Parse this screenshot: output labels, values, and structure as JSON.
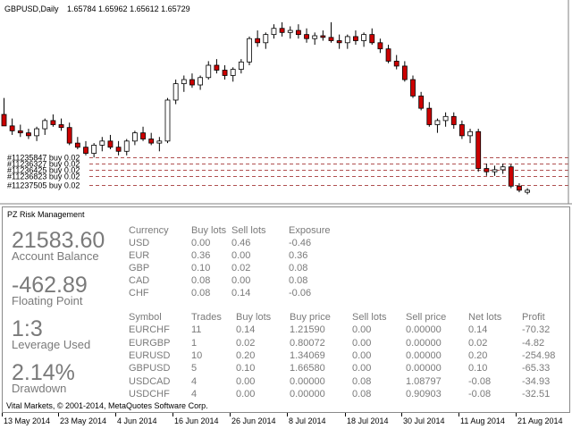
{
  "chart_data": {
    "type": "candlestick",
    "symbol_header": "GBPUSD,Daily",
    "ohlc_header": "1.65784 1.65962 1.65612 1.65729",
    "candles": [
      {
        "o": 1.7,
        "h": 1.704,
        "l": 1.699,
        "c": 1.6972,
        "dir": "down"
      },
      {
        "o": 1.6972,
        "h": 1.699,
        "l": 1.695,
        "c": 1.696,
        "dir": "down"
      },
      {
        "o": 1.696,
        "h": 1.6975,
        "l": 1.6945,
        "c": 1.6955,
        "dir": "down"
      },
      {
        "o": 1.6955,
        "h": 1.6965,
        "l": 1.694,
        "c": 1.6948,
        "dir": "down"
      },
      {
        "o": 1.6948,
        "h": 1.697,
        "l": 1.6935,
        "c": 1.6965,
        "dir": "up"
      },
      {
        "o": 1.6965,
        "h": 1.699,
        "l": 1.695,
        "c": 1.6985,
        "dir": "up"
      },
      {
        "o": 1.6985,
        "h": 1.7,
        "l": 1.697,
        "c": 1.6975,
        "dir": "down"
      },
      {
        "o": 1.6975,
        "h": 1.699,
        "l": 1.696,
        "c": 1.6968,
        "dir": "down"
      },
      {
        "o": 1.6968,
        "h": 1.698,
        "l": 1.6925,
        "c": 1.693,
        "dir": "down"
      },
      {
        "o": 1.693,
        "h": 1.6945,
        "l": 1.6915,
        "c": 1.692,
        "dir": "down"
      },
      {
        "o": 1.692,
        "h": 1.6935,
        "l": 1.69,
        "c": 1.6905,
        "dir": "down"
      },
      {
        "o": 1.6905,
        "h": 1.693,
        "l": 1.6895,
        "c": 1.6925,
        "dir": "up"
      },
      {
        "o": 1.6925,
        "h": 1.6945,
        "l": 1.691,
        "c": 1.6935,
        "dir": "up"
      },
      {
        "o": 1.6935,
        "h": 1.695,
        "l": 1.6915,
        "c": 1.692,
        "dir": "down"
      },
      {
        "o": 1.692,
        "h": 1.6935,
        "l": 1.69,
        "c": 1.691,
        "dir": "down"
      },
      {
        "o": 1.691,
        "h": 1.694,
        "l": 1.69,
        "c": 1.6935,
        "dir": "up"
      },
      {
        "o": 1.6935,
        "h": 1.696,
        "l": 1.6925,
        "c": 1.6955,
        "dir": "up"
      },
      {
        "o": 1.6955,
        "h": 1.697,
        "l": 1.6935,
        "c": 1.694,
        "dir": "down"
      },
      {
        "o": 1.694,
        "h": 1.6955,
        "l": 1.6925,
        "c": 1.693,
        "dir": "down"
      },
      {
        "o": 1.693,
        "h": 1.6945,
        "l": 1.691,
        "c": 1.6935,
        "dir": "up"
      },
      {
        "o": 1.6935,
        "h": 1.704,
        "l": 1.693,
        "c": 1.7035,
        "dir": "up"
      },
      {
        "o": 1.7035,
        "h": 1.7085,
        "l": 1.7025,
        "c": 1.7075,
        "dir": "up"
      },
      {
        "o": 1.7075,
        "h": 1.7095,
        "l": 1.7055,
        "c": 1.7085,
        "dir": "up"
      },
      {
        "o": 1.7085,
        "h": 1.71,
        "l": 1.7065,
        "c": 1.7072,
        "dir": "down"
      },
      {
        "o": 1.7072,
        "h": 1.7095,
        "l": 1.706,
        "c": 1.709,
        "dir": "up"
      },
      {
        "o": 1.709,
        "h": 1.713,
        "l": 1.7085,
        "c": 1.712,
        "dir": "up"
      },
      {
        "o": 1.712,
        "h": 1.7135,
        "l": 1.71,
        "c": 1.7108,
        "dir": "down"
      },
      {
        "o": 1.7108,
        "h": 1.712,
        "l": 1.7085,
        "c": 1.7095,
        "dir": "down"
      },
      {
        "o": 1.7095,
        "h": 1.7115,
        "l": 1.708,
        "c": 1.711,
        "dir": "up"
      },
      {
        "o": 1.711,
        "h": 1.7135,
        "l": 1.71,
        "c": 1.7128,
        "dir": "up"
      },
      {
        "o": 1.7128,
        "h": 1.719,
        "l": 1.712,
        "c": 1.7185,
        "dir": "up"
      },
      {
        "o": 1.7185,
        "h": 1.7205,
        "l": 1.7165,
        "c": 1.7175,
        "dir": "down"
      },
      {
        "o": 1.7175,
        "h": 1.72,
        "l": 1.716,
        "c": 1.7195,
        "dir": "up"
      },
      {
        "o": 1.7195,
        "h": 1.722,
        "l": 1.7185,
        "c": 1.721,
        "dir": "up"
      },
      {
        "o": 1.721,
        "h": 1.7225,
        "l": 1.719,
        "c": 1.72,
        "dir": "down"
      },
      {
        "o": 1.72,
        "h": 1.7215,
        "l": 1.7185,
        "c": 1.7205,
        "dir": "up"
      },
      {
        "o": 1.7205,
        "h": 1.722,
        "l": 1.7185,
        "c": 1.7195,
        "dir": "down"
      },
      {
        "o": 1.7195,
        "h": 1.721,
        "l": 1.7175,
        "c": 1.7185,
        "dir": "down"
      },
      {
        "o": 1.7185,
        "h": 1.72,
        "l": 1.717,
        "c": 1.7192,
        "dir": "up"
      },
      {
        "o": 1.7192,
        "h": 1.7205,
        "l": 1.718,
        "c": 1.7188,
        "dir": "down"
      },
      {
        "o": 1.7188,
        "h": 1.7225,
        "l": 1.7175,
        "c": 1.718,
        "dir": "down"
      },
      {
        "o": 1.718,
        "h": 1.7195,
        "l": 1.716,
        "c": 1.7175,
        "dir": "down"
      },
      {
        "o": 1.7175,
        "h": 1.7195,
        "l": 1.716,
        "c": 1.719,
        "dir": "up"
      },
      {
        "o": 1.719,
        "h": 1.7205,
        "l": 1.717,
        "c": 1.718,
        "dir": "down"
      },
      {
        "o": 1.718,
        "h": 1.72,
        "l": 1.7165,
        "c": 1.7195,
        "dir": "up"
      },
      {
        "o": 1.7195,
        "h": 1.721,
        "l": 1.717,
        "c": 1.7175,
        "dir": "down"
      },
      {
        "o": 1.7175,
        "h": 1.7185,
        "l": 1.715,
        "c": 1.716,
        "dir": "down"
      },
      {
        "o": 1.716,
        "h": 1.717,
        "l": 1.7125,
        "c": 1.713,
        "dir": "down"
      },
      {
        "o": 1.713,
        "h": 1.7145,
        "l": 1.711,
        "c": 1.7118,
        "dir": "down"
      },
      {
        "o": 1.7118,
        "h": 1.713,
        "l": 1.708,
        "c": 1.7085,
        "dir": "down"
      },
      {
        "o": 1.7085,
        "h": 1.7095,
        "l": 1.704,
        "c": 1.7045,
        "dir": "down"
      },
      {
        "o": 1.7045,
        "h": 1.7055,
        "l": 1.701,
        "c": 1.7015,
        "dir": "down"
      },
      {
        "o": 1.7015,
        "h": 1.703,
        "l": 1.697,
        "c": 1.6975,
        "dir": "down"
      },
      {
        "o": 1.6975,
        "h": 1.699,
        "l": 1.6955,
        "c": 1.6985,
        "dir": "up"
      },
      {
        "o": 1.6985,
        "h": 1.7005,
        "l": 1.697,
        "c": 1.6995,
        "dir": "up"
      },
      {
        "o": 1.6995,
        "h": 1.7005,
        "l": 1.6965,
        "c": 1.6975,
        "dir": "down"
      },
      {
        "o": 1.6975,
        "h": 1.6985,
        "l": 1.694,
        "c": 1.6948,
        "dir": "down"
      },
      {
        "o": 1.6948,
        "h": 1.6965,
        "l": 1.693,
        "c": 1.6958,
        "dir": "up"
      },
      {
        "o": 1.6958,
        "h": 1.6965,
        "l": 1.686,
        "c": 1.6868,
        "dir": "down"
      },
      {
        "o": 1.6868,
        "h": 1.688,
        "l": 1.685,
        "c": 1.686,
        "dir": "down"
      },
      {
        "o": 1.686,
        "h": 1.6875,
        "l": 1.685,
        "c": 1.6865,
        "dir": "up"
      },
      {
        "o": 1.6865,
        "h": 1.688,
        "l": 1.6855,
        "c": 1.6872,
        "dir": "up"
      },
      {
        "o": 1.6872,
        "h": 1.6878,
        "l": 1.682,
        "c": 1.6825,
        "dir": "down"
      },
      {
        "o": 1.6825,
        "h": 1.6832,
        "l": 1.681,
        "c": 1.6815,
        "dir": "down"
      },
      {
        "o": 1.6815,
        "h": 1.682,
        "l": 1.6805,
        "c": 1.681,
        "dir": "up"
      }
    ],
    "y_range": [
      1.6795,
      1.724
    ],
    "x_ticks": [
      "13 May 2014",
      "23 May 2014",
      "4 Jun 2014",
      "16 Jun 2014",
      "26 Jun 2014",
      "8 Jul 2014",
      "18 Jul 2014",
      "30 Jul 2014",
      "11 Aug 2014",
      "21 Aug 2014"
    ],
    "order_lines": [
      {
        "label": "#11235847 buy 0.02",
        "price": 1.6895
      },
      {
        "label": "#11236327 buy 0.02",
        "price": 1.688
      },
      {
        "label": "#11236425 buy 0.02",
        "price": 1.6865
      },
      {
        "label": "#11236823 buy 0.02",
        "price": 1.685
      },
      {
        "label": "#11237505 buy 0.02",
        "price": 1.6828
      }
    ],
    "colors": {
      "up": "#ffffff",
      "down": "#cc0000",
      "outline": "#000000",
      "order_line": "#b05050"
    }
  },
  "panel": {
    "title": "PZ Risk Management",
    "stats": [
      {
        "value": "21583.60",
        "label": "Account Balance"
      },
      {
        "value": "-462.89",
        "label": "Floating Point"
      },
      {
        "value": "1:3",
        "label": "Leverage Used"
      },
      {
        "value": "2.14%",
        "label": "Drawdown"
      }
    ],
    "exposure": {
      "headers": [
        "Currency",
        "Buy lots",
        "Sell lots",
        "Exposure"
      ],
      "rows": [
        [
          "USD",
          "0.00",
          "0.46",
          "-0.46"
        ],
        [
          "EUR",
          "0.36",
          "0.00",
          "0.36"
        ],
        [
          "GBP",
          "0.10",
          "0.02",
          "0.08"
        ],
        [
          "CAD",
          "0.08",
          "0.00",
          "0.08"
        ],
        [
          "CHF",
          "0.08",
          "0.14",
          "-0.06"
        ]
      ]
    },
    "symbols": {
      "headers": [
        "Symbol",
        "Trades",
        "Buy lots",
        "Buy price",
        "Sell lots",
        "Sell price",
        "Net lots",
        "Profit"
      ],
      "rows": [
        [
          "EURCHF",
          "11",
          "0.14",
          "1.21590",
          "0.00",
          "0.00000",
          "0.14",
          "-70.32"
        ],
        [
          "EURGBP",
          "1",
          "0.02",
          "0.80072",
          "0.00",
          "0.00000",
          "0.02",
          "-4.82"
        ],
        [
          "EURUSD",
          "10",
          "0.20",
          "1.34069",
          "0.00",
          "0.00000",
          "0.20",
          "-254.98"
        ],
        [
          "GBPUSD",
          "5",
          "0.10",
          "1.66580",
          "0.00",
          "0.00000",
          "0.10",
          "-65.33"
        ],
        [
          "USDCAD",
          "4",
          "0.00",
          "0.00000",
          "0.08",
          "1.08797",
          "-0.08",
          "-34.93"
        ],
        [
          "USDCHF",
          "4",
          "0.00",
          "0.00000",
          "0.08",
          "0.90903",
          "-0.08",
          "-32.51"
        ]
      ]
    },
    "footer": "Vital Markets, © 2001-2014, MetaQuotes Software Corp."
  }
}
